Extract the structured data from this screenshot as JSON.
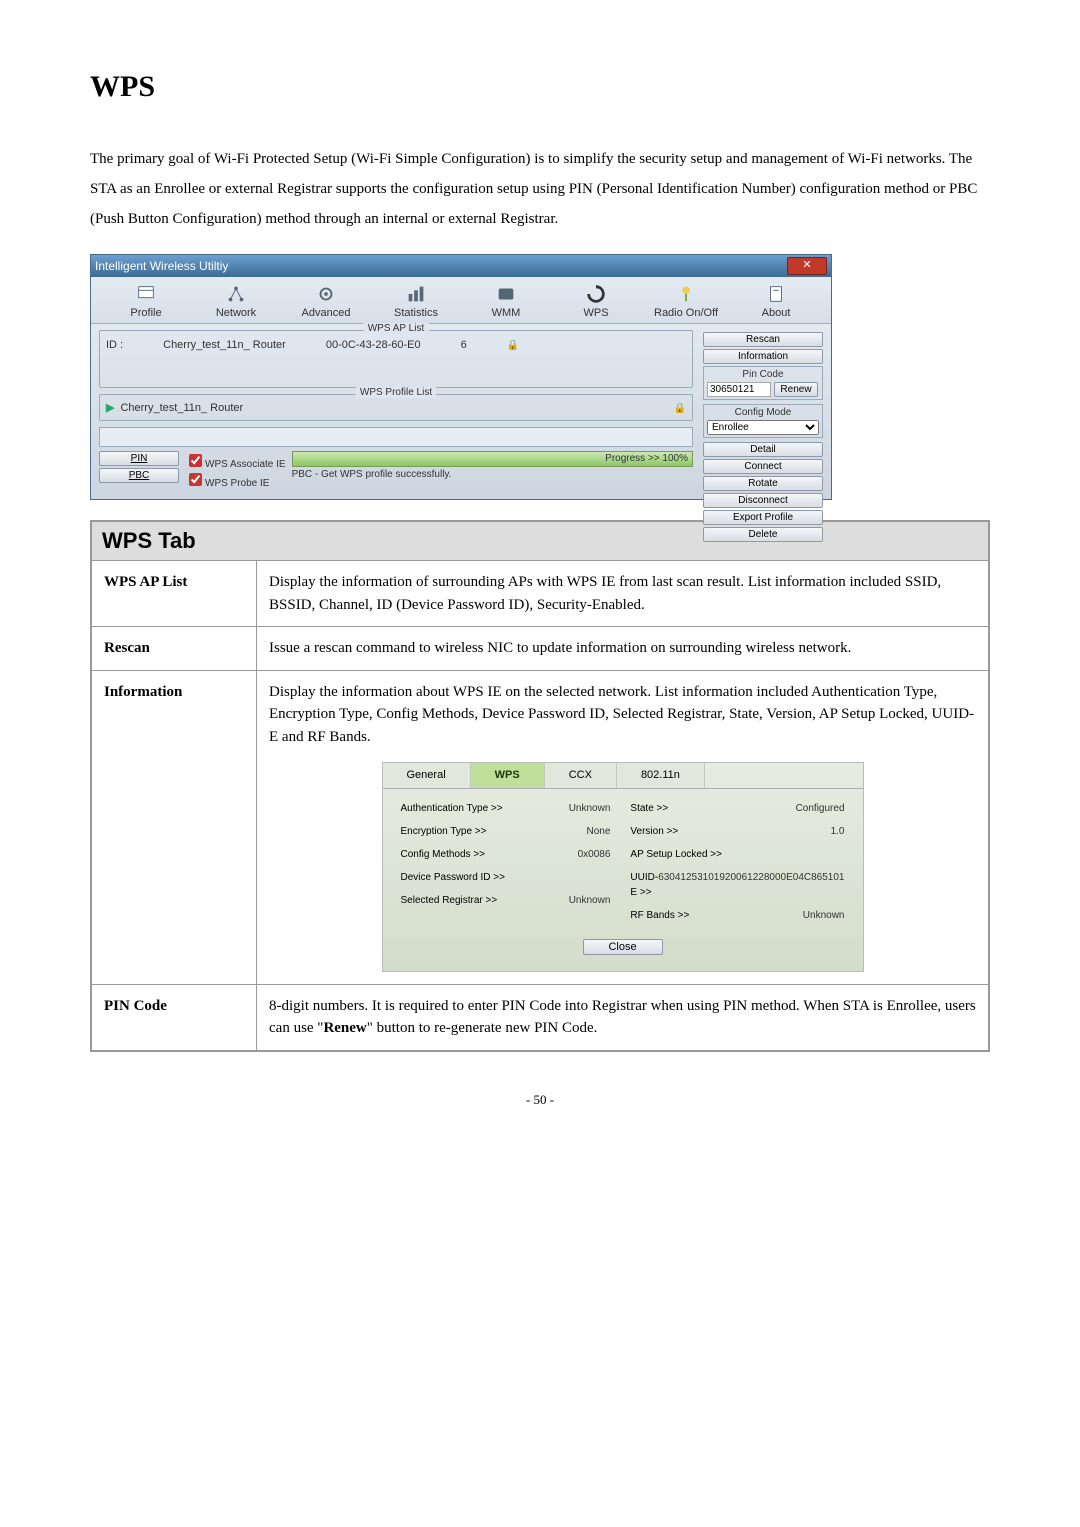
{
  "page_title": "WPS",
  "intro_text": "The primary goal of Wi-Fi Protected Setup (Wi-Fi Simple Configuration) is to simplify the security setup and management of Wi-Fi networks. The STA as an Enrollee or external Registrar supports the configuration setup using PIN (Personal Identification Number) configuration method or PBC (Push Button Configuration) method through an internal or external Registrar.",
  "utility": {
    "window_title": "Intelligent Wireless Utiltiy",
    "tabs": [
      "Profile",
      "Network",
      "Advanced",
      "Statistics",
      "WMM",
      "WPS",
      "Radio On/Off",
      "About"
    ],
    "wps_ap_list_title": "WPS AP List",
    "ap_row": {
      "id_label": "ID :",
      "ssid": "Cherry_test_11n_ Router",
      "bssid": "00-0C-43-28-60-E0",
      "channel": "6"
    },
    "wps_profile_list_title": "WPS Profile List",
    "profile_row": {
      "ssid": "Cherry_test_11n_ Router"
    },
    "right_buttons": {
      "rescan": "Rescan",
      "information": "Information",
      "pin_code_legend": "Pin Code",
      "pin_value": "30650121",
      "renew": "Renew",
      "config_mode_legend": "Config Mode",
      "config_mode_value": "Enrollee",
      "detail": "Detail",
      "connect": "Connect",
      "rotate": "Rotate",
      "disconnect": "Disconnect",
      "export": "Export Profile",
      "delete": "Delete"
    },
    "pin_btn": "PIN",
    "pbc_btn": "PBC",
    "assoc_ie": "WPS Associate IE",
    "probe_ie": "WPS Probe IE",
    "progress_text": "Progress >> 100%",
    "status_text": "PBC - Get WPS profile successfully."
  },
  "desc_table": {
    "header": "WPS Tab",
    "rows": [
      {
        "key": "WPS AP List",
        "val": "Display the information of surrounding APs with WPS IE from last scan result. List information included SSID, BSSID, Channel, ID (Device Password ID), Security-Enabled."
      },
      {
        "key": "Rescan",
        "val": "Issue a rescan command to wireless NIC to update information on surrounding wireless network."
      },
      {
        "key": "Information",
        "val": "Display the information about WPS IE on the selected network. List information included Authentication Type, Encryption Type, Config Methods, Device Password ID, Selected Registrar, State, Version, AP Setup Locked, UUID-E and RF Bands."
      },
      {
        "key": "PIN Code",
        "val_pre": "8-digit numbers. It is required to enter PIN Code into Registrar when using PIN method. When STA is Enrollee, users can use \"",
        "val_bold": "Renew",
        "val_post": "\" button to re-generate new PIN Code."
      }
    ]
  },
  "info_dialog": {
    "tabs": [
      "General",
      "WPS",
      "CCX",
      "802.11n"
    ],
    "left": [
      {
        "lbl": "Authentication Type",
        "val": "Unknown"
      },
      {
        "lbl": "Encryption Type",
        "val": "None"
      },
      {
        "lbl": "Config Methods",
        "val": "0x0086"
      },
      {
        "lbl": "Device Password ID",
        "val": ""
      },
      {
        "lbl": "Selected Registrar",
        "val": "Unknown"
      }
    ],
    "right": [
      {
        "lbl": "State",
        "val": "Configured"
      },
      {
        "lbl": "Version",
        "val": "1.0"
      },
      {
        "lbl": "AP Setup Locked",
        "val": ""
      },
      {
        "lbl": "UUID-E",
        "val": "63041253101920061228000E04C865101"
      },
      {
        "lbl": "RF Bands",
        "val": "Unknown"
      }
    ],
    "close": "Close"
  },
  "page_number": "- 50 -"
}
